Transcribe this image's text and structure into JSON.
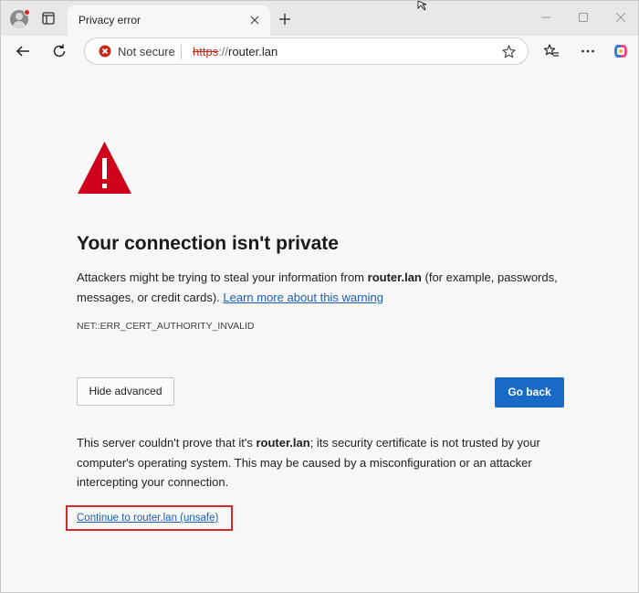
{
  "tab": {
    "title": "Privacy error"
  },
  "address": {
    "security_label": "Not secure",
    "url_scheme": "https",
    "url_separator": "://",
    "url_host": "router.lan"
  },
  "content": {
    "heading": "Your connection isn't private",
    "desc_prefix": "Attackers might be trying to steal your information from ",
    "desc_host": "router.lan",
    "desc_suffix": " (for example, passwords, messages, or credit cards). ",
    "learn_more_link": "Learn more about this warning",
    "error_code": "NET::ERR_CERT_AUTHORITY_INVALID",
    "hide_advanced_label": "Hide advanced",
    "go_back_label": "Go back",
    "details_prefix": "This server couldn't prove that it's ",
    "details_host": "router.lan",
    "details_suffix": "; its security certificate is not trusted by your computer's operating system. This may be caused by a misconfiguration or an attacker intercepting your connection.",
    "continue_link": "Continue to router.lan (unsafe)"
  },
  "icons": {
    "profile": "profile-avatar-icon",
    "tab_actions": "tab-actions-icon",
    "new_tab": "plus-icon",
    "back": "arrow-left-icon",
    "reload": "reload-icon",
    "not_secure": "warning-circle-icon",
    "favorite": "star-icon",
    "favorites": "favorites-star-list-icon",
    "more": "more-ellipsis-icon",
    "copilot": "copilot-icon",
    "warning": "warning-triangle-icon"
  },
  "colors": {
    "accent": "#1969c6",
    "danger": "#c42b1c",
    "link": "#1a5fb4",
    "highlight_box": "#d6282b"
  }
}
